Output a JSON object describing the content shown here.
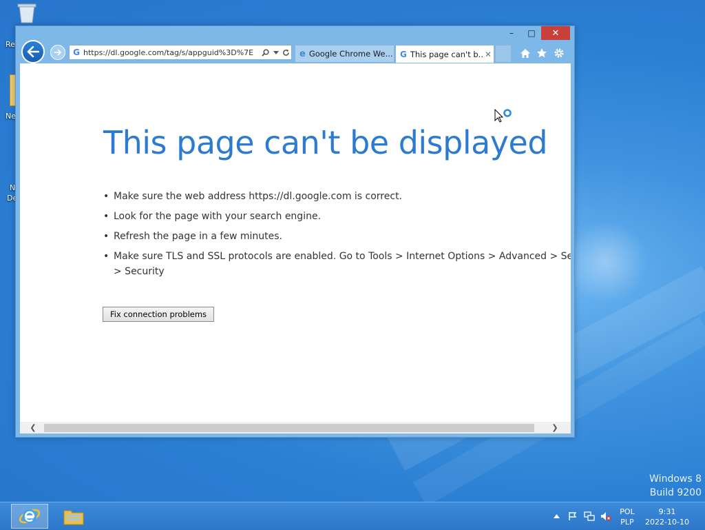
{
  "desktop": {
    "icon_labels": [
      "Re",
      "Ne",
      "N",
      "De"
    ],
    "watermark": {
      "line1": "Windows 8",
      "line2": "Build 9200"
    }
  },
  "browser": {
    "address": {
      "url": "https://dl.google.com/tag/s/appguid%3D%7E",
      "search_icon": "search-icon",
      "dropdown_icon": "chevron-down-icon",
      "refresh_icon": "refresh-icon"
    },
    "tabs": [
      {
        "label": "Google Chrome We...",
        "icon": "ie-icon",
        "active": false
      },
      {
        "label": "This page can't b...",
        "icon": "google-icon",
        "active": true
      }
    ],
    "caption": {
      "minimize": "–",
      "maximize": "□",
      "close": "✕"
    }
  },
  "page": {
    "title": "This page can't be displayed",
    "bullets": [
      "Make sure the web address https://dl.google.com is correct.",
      "Look for the page with your search engine.",
      "Refresh the page in a few minutes.",
      "Make sure TLS and SSL protocols are enabled. Go to Tools > Internet Options > Advanced > Settings",
      "> Security"
    ],
    "fix_button": "Fix connection problems"
  },
  "taskbar": {
    "lang_top": "POL",
    "lang_bottom": "PLP",
    "time": "9:31",
    "date": "2022-10-10"
  },
  "colors": {
    "accent": "#2d7bd0",
    "close": "#c7413a",
    "desktop": "#2b7fd3"
  }
}
